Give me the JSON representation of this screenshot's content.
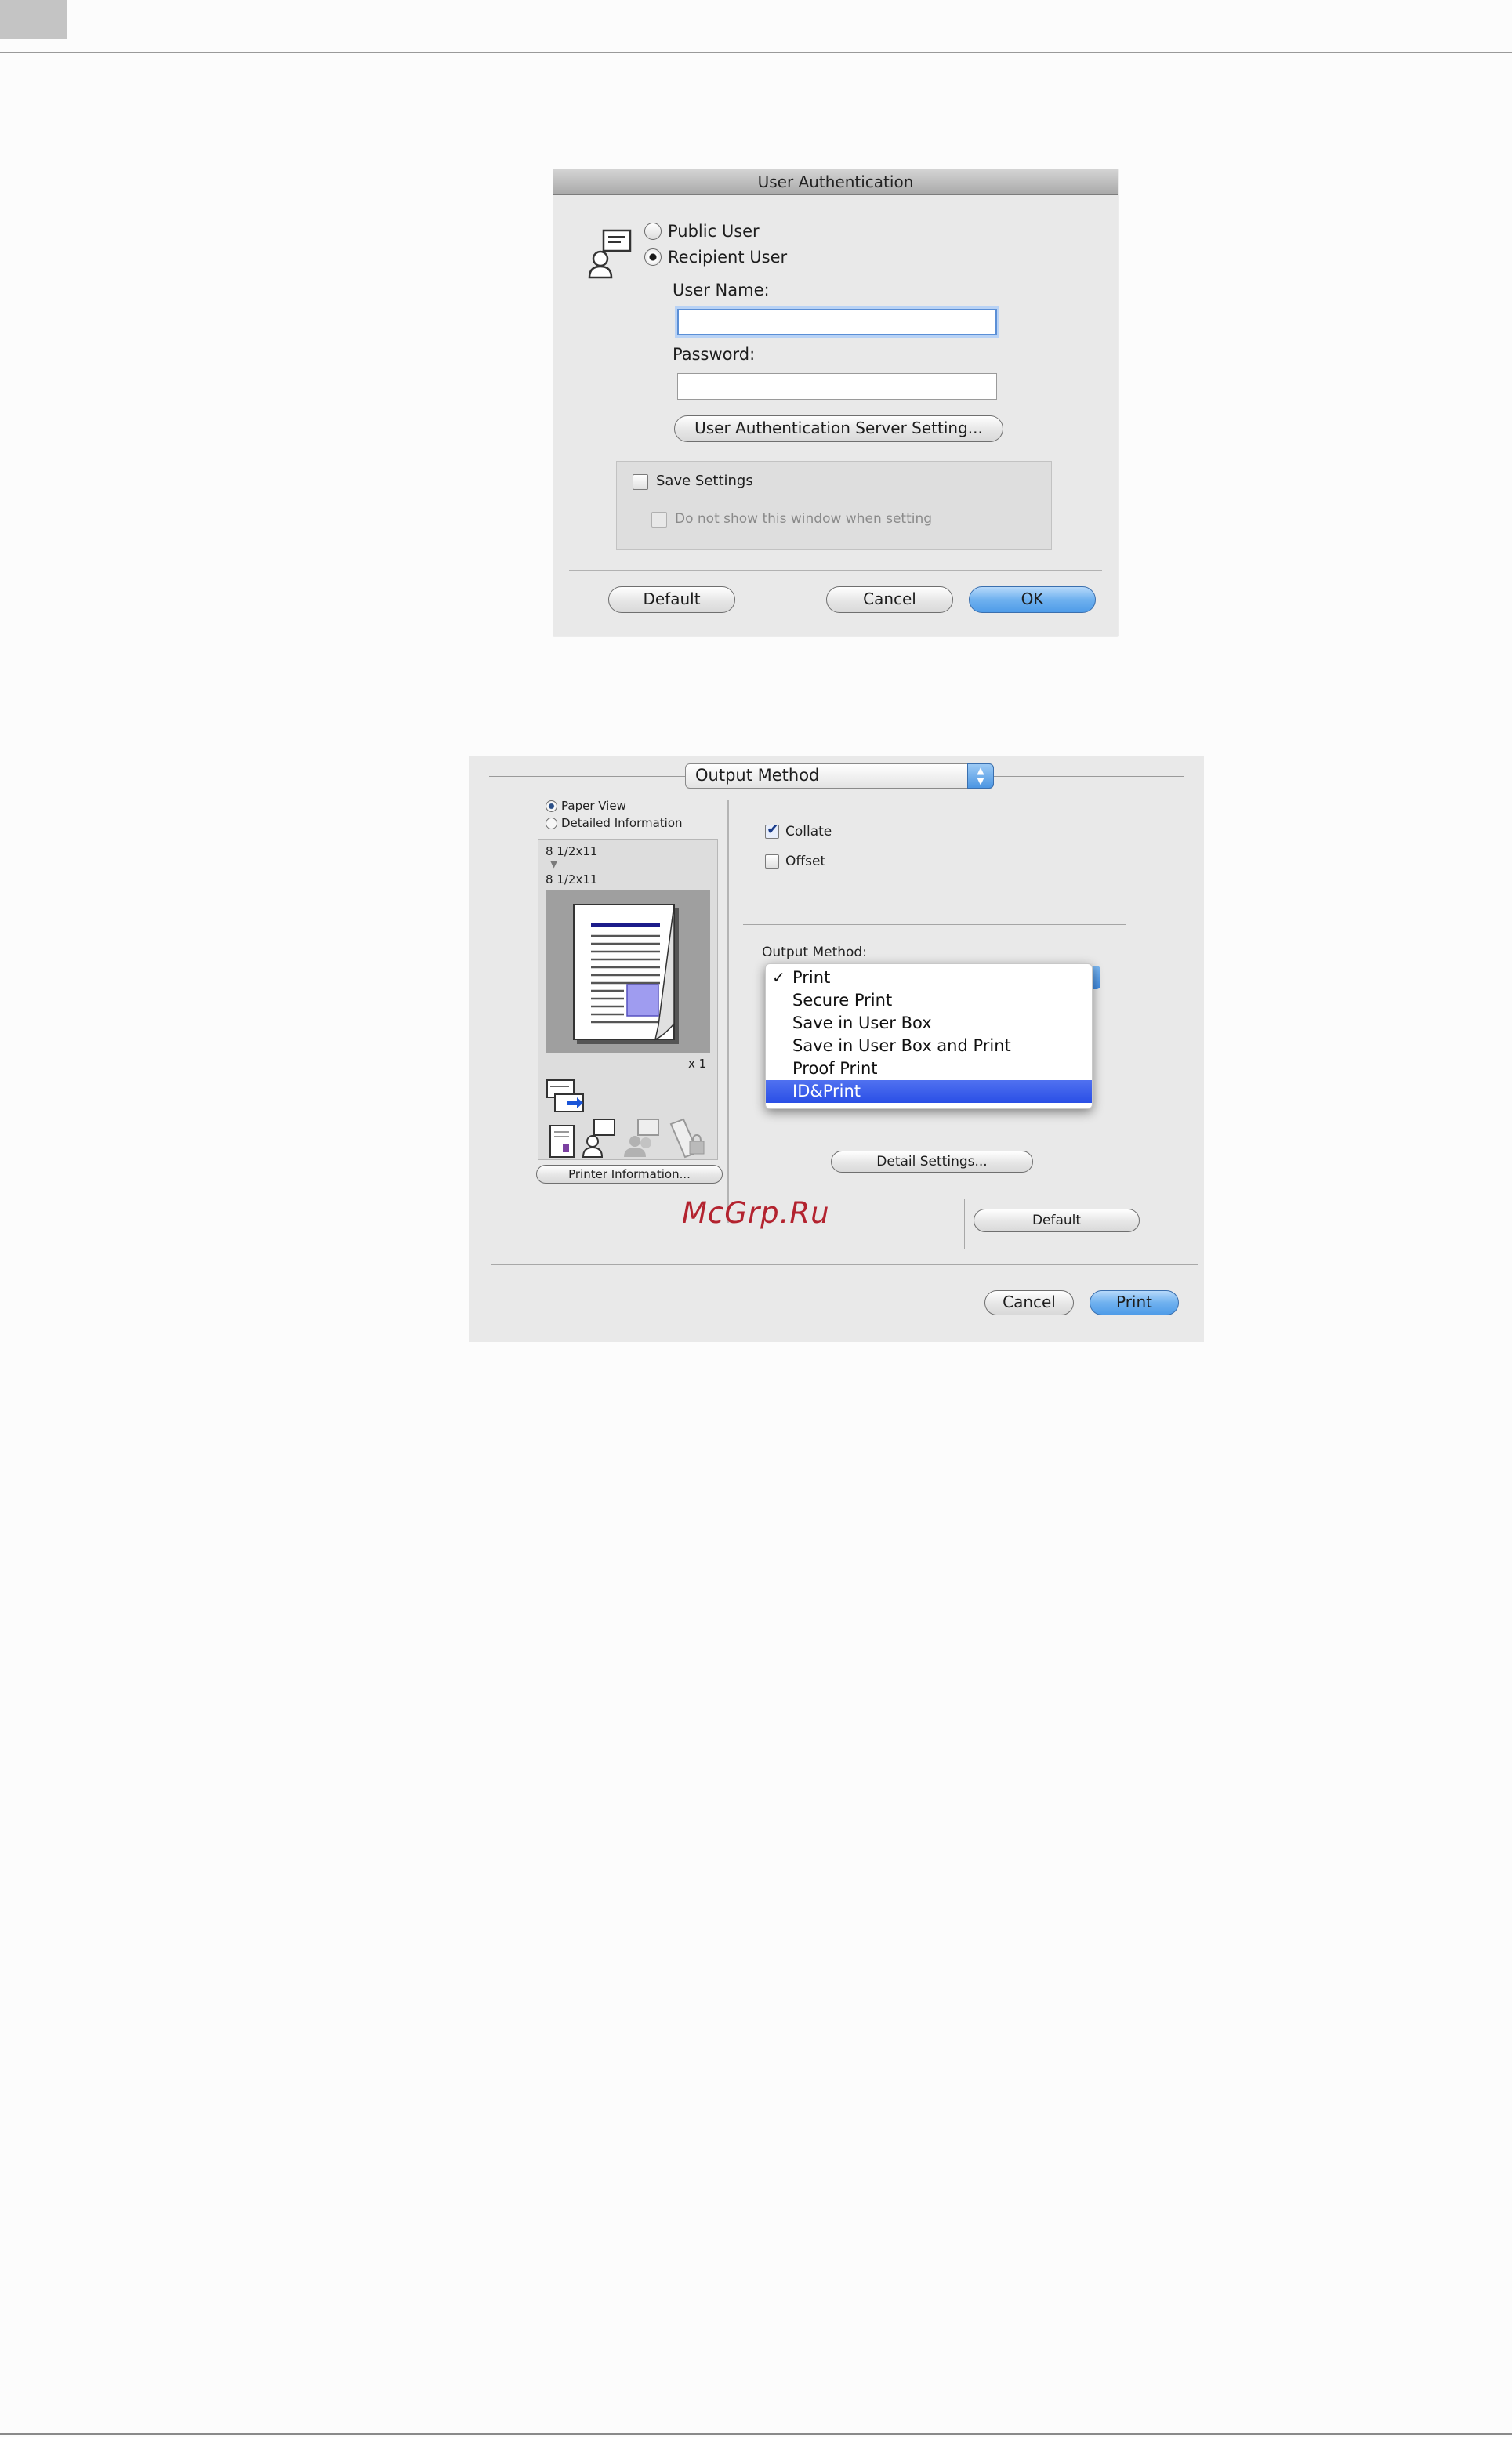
{
  "dialog_auth": {
    "title": "User Authentication",
    "public_user_label": "Public User",
    "recipient_user_label": "Recipient User",
    "user_name_label": "User Name:",
    "user_name_value": "",
    "password_label": "Password:",
    "password_value": "",
    "server_setting_button": "User Authentication Server Setting...",
    "save_settings_label": "Save Settings",
    "do_not_show_label": "Do not show this window when setting",
    "default_button": "Default",
    "cancel_button": "Cancel",
    "ok_button": "OK"
  },
  "dialog_print": {
    "panel_popup": "Output Method",
    "paper_view_label": "Paper View",
    "detailed_info_label": "Detailed Information",
    "paper_from": "8 1/2x11",
    "paper_to": "8 1/2x11",
    "copies": "x 1",
    "printer_info_button": "Printer Information...",
    "collate_label": "Collate",
    "offset_label": "Offset",
    "output_method_label": "Output Method:",
    "output_method_options": [
      {
        "label": "Print",
        "checked": true,
        "highlighted": false
      },
      {
        "label": "Secure Print",
        "checked": false,
        "highlighted": false
      },
      {
        "label": "Save in User Box",
        "checked": false,
        "highlighted": false
      },
      {
        "label": "Save in User Box and Print",
        "checked": false,
        "highlighted": false
      },
      {
        "label": "Proof Print",
        "checked": false,
        "highlighted": false
      },
      {
        "label": "ID&Print",
        "checked": false,
        "highlighted": true
      }
    ],
    "check_mark": "✓",
    "detail_settings_button": "Detail Settings...",
    "default_button": "Default",
    "cancel_button": "Cancel",
    "print_button": "Print",
    "watermark": "McGrp.Ru"
  },
  "colors": {
    "accent_blue": "#4f9ce8",
    "highlight": "#2a4fe6",
    "watermark": "#b3232f"
  }
}
